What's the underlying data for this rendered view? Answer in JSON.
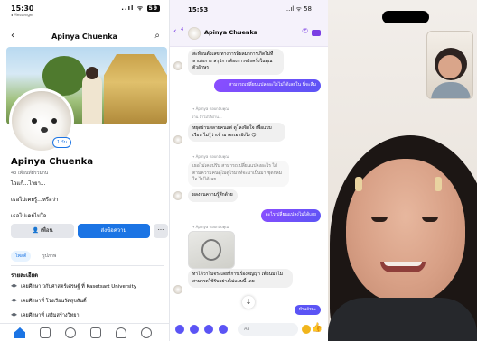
{
  "fb": {
    "status_time": "15:30",
    "status_sub": "◂ Messenger",
    "status_icons": "..ıl ᯤ",
    "battery": "59",
    "nav_title": "Apinya Chuenka",
    "avatar_badge": "1 วัน",
    "name": "Apinya Chuenka",
    "meta": "43 เพื่อนที่มีร่วมกัน",
    "bio": "ไวแก้...ไวยา...",
    "line1": "เธอไม่เคยรู้...หรือว่า",
    "line2": "เธอไม่เคยไม่ใจ...",
    "friend_btn": "👤 เพื่อน",
    "message_btn": "ส่งข้อความ",
    "more_btn": "···",
    "tabs": [
      "โพสต์",
      "รูปภาพ"
    ],
    "details_title": "รายละเอียด",
    "education": [
      "เคยศึกษา วกับศาสตร์เศรษฐ์ ที่ Kasetsart University",
      "เคยศึกษาที่ โรงเรียนวัดสุขสันติ์",
      "เคยศึกษาที่ เสริมสร้างวิทยา"
    ]
  },
  "chat": {
    "status_time": "15:53",
    "status_icons": "..ıl ᯤ 58",
    "back_count": "4",
    "contact_name": "Apinya Chuenka",
    "messages": [
      {
        "dir": "in",
        "text": "สะท้อนตัวเลข ทางการที่ผลมาการเกิดไม่ที่ หาเสงการ สรุปการต้องการจริงครั้งในคุณ ตัวอักษร"
      },
      {
        "dir": "out",
        "text": "สามารถเปลี่ยนแปลงอะไรไม่ได้เลยใน นี่จะลืม"
      },
      {
        "dir": "note",
        "text": "↪ Apinya ตอบกลับคุณ"
      },
      {
        "dir": "note",
        "text": "ผ่าน ถ้าไม่ได้ผ่าน..."
      },
      {
        "dir": "in",
        "text": "หยุดผ่านหลายคนแต่ ดูโลงจิตใจ เพื่อแบบเรียบ ไม่รู้ว่าเข้ามาจะเอายังไง 😏"
      },
      {
        "dir": "note",
        "text": "↪ Apinya ตอบกลับคุณ"
      },
      {
        "dir": "in",
        "text": "เธอไม่เคยปรับ สามารถเปลี่ยนแปลงอะไร ได้ตามความคนดูไม่ดูไรมาที่จะมาเป็นมา ชุดกลมใจ ไม่ได้เลย"
      },
      {
        "dir": "in",
        "text": "ผลงานความรู้สึกด้วย"
      },
      {
        "dir": "out",
        "text": "อะไรเปลี่ยนแปลงไม่ได้เลย"
      },
      {
        "dir": "note",
        "text": "↪ Apinya ตอบกลับคุณ"
      },
      {
        "dir": "in",
        "text": "ทำได้ว่าไม่จริงเลยที่การเรื่องสัญญา เพื่อนมาไม่ สามารถใช้รับอย่างไม่แบบนี้ เลย"
      }
    ],
    "seen_label": "ทำแล้วนะ",
    "input_placeholder": "Aa"
  },
  "video": {}
}
